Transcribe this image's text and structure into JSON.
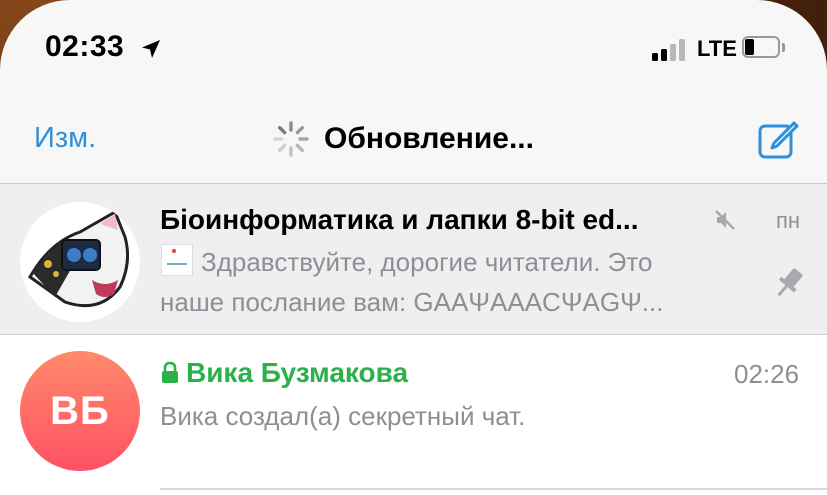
{
  "status_bar": {
    "time": "02:33",
    "network": "LTE",
    "signal_bars_active": 2,
    "signal_bars_total": 4,
    "battery_level": 0.2
  },
  "navbar": {
    "edit_label": "Изм.",
    "title": "Обновление..."
  },
  "chats": [
    {
      "title": "Біоинформатика и лапки 8-bit ed...",
      "date": "пн",
      "preview_line1": "Здравствуйте, дорогие читатели. Это",
      "preview_line2": "наше послание вам:  GAAΨAAACΨAGΨ...",
      "muted": true,
      "pinned": true
    },
    {
      "initials": "ВБ",
      "title": "Вика Бузмакова",
      "time": "02:26",
      "preview": "Вика создал(а) секретный чат.",
      "secret": true
    }
  ],
  "colors": {
    "accent": "#2f8fd8",
    "secret_green": "#2ab14a",
    "secondary_text": "#8e8e93",
    "avatar_gradient_top": "#ff8a6a",
    "avatar_gradient_bottom": "#ff5164"
  },
  "icons": [
    "location-arrow-icon",
    "signal-icon",
    "battery-icon",
    "spinner-icon",
    "compose-icon",
    "mute-icon",
    "pin-icon",
    "lock-icon"
  ]
}
